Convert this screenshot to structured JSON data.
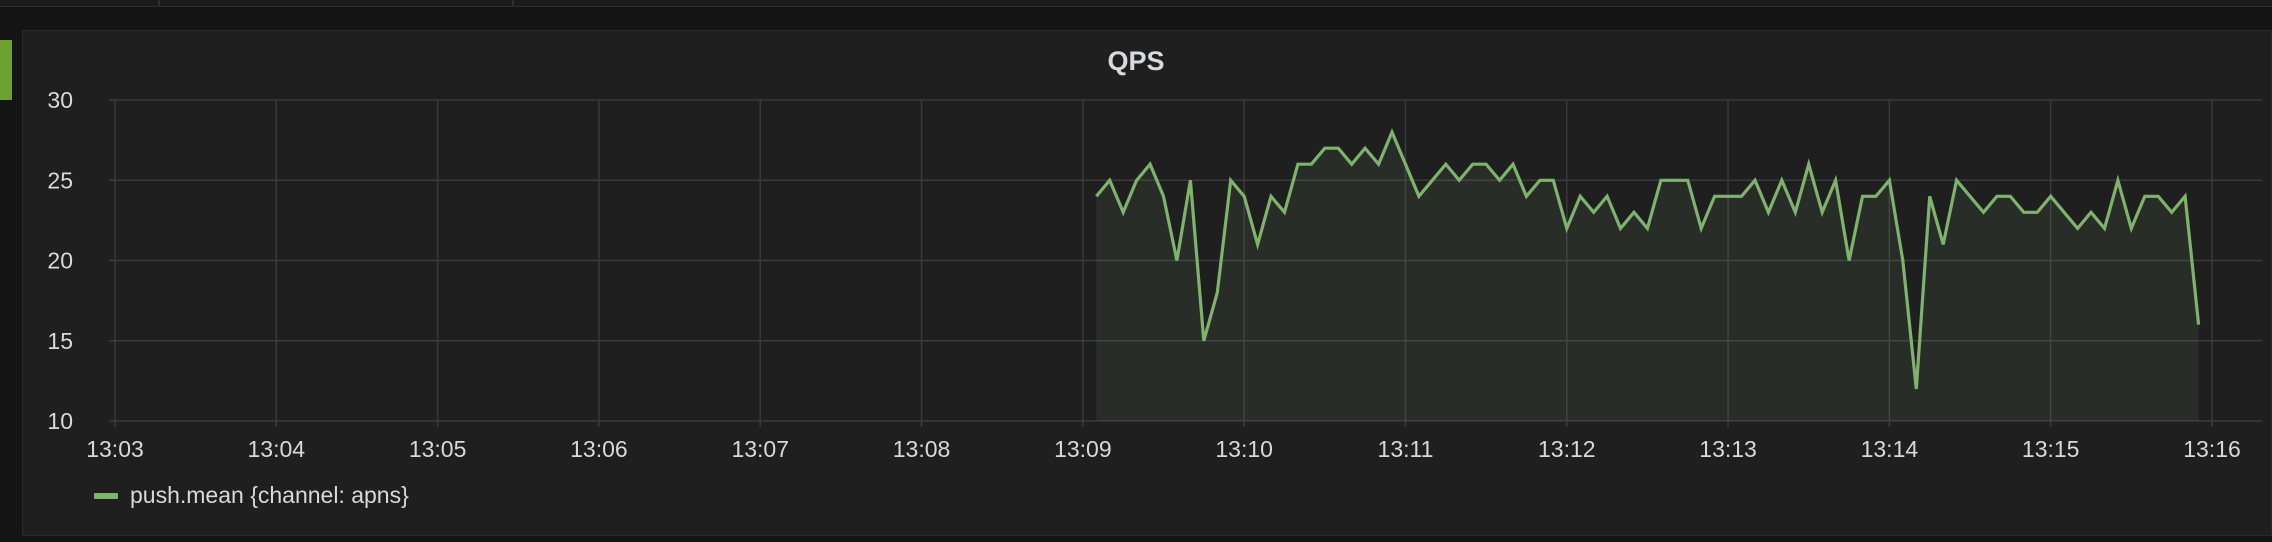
{
  "panel": {
    "title": "QPS"
  },
  "chart_data": {
    "type": "area",
    "title": "QPS",
    "xlabel": "",
    "ylabel": "",
    "x_ticks": [
      "13:03",
      "13:04",
      "13:05",
      "13:06",
      "13:07",
      "13:08",
      "13:09",
      "13:10",
      "13:11",
      "13:12",
      "13:13",
      "13:14",
      "13:15",
      "13:16"
    ],
    "x_range": [
      "13:03",
      "13:16"
    ],
    "y_ticks": [
      10,
      15,
      20,
      25,
      30
    ],
    "ylim": [
      10,
      30
    ],
    "grid": true,
    "legend_placement": "bottom-left",
    "series": [
      {
        "name": "push.mean {channel: apns}",
        "color": "#7eb26d",
        "x": [
          "13:09:05",
          "13:09:10",
          "13:09:15",
          "13:09:20",
          "13:09:25",
          "13:09:30",
          "13:09:35",
          "13:09:40",
          "13:09:45",
          "13:09:50",
          "13:09:55",
          "13:10:00",
          "13:10:05",
          "13:10:10",
          "13:10:15",
          "13:10:20",
          "13:10:25",
          "13:10:30",
          "13:10:35",
          "13:10:40",
          "13:10:45",
          "13:10:50",
          "13:10:55",
          "13:11:00",
          "13:11:05",
          "13:11:10",
          "13:11:15",
          "13:11:20",
          "13:11:25",
          "13:11:30",
          "13:11:35",
          "13:11:40",
          "13:11:45",
          "13:11:50",
          "13:11:55",
          "13:12:00",
          "13:12:05",
          "13:12:10",
          "13:12:15",
          "13:12:20",
          "13:12:25",
          "13:12:30",
          "13:12:35",
          "13:12:40",
          "13:12:45",
          "13:12:50",
          "13:12:55",
          "13:13:00",
          "13:13:05",
          "13:13:10",
          "13:13:15",
          "13:13:20",
          "13:13:25",
          "13:13:30",
          "13:13:35",
          "13:13:40",
          "13:13:45",
          "13:13:50",
          "13:13:55",
          "13:14:00",
          "13:14:05",
          "13:14:10",
          "13:14:15",
          "13:14:20",
          "13:14:25",
          "13:14:30",
          "13:14:35",
          "13:14:40",
          "13:14:45",
          "13:14:50",
          "13:14:55",
          "13:15:00",
          "13:15:05",
          "13:15:10",
          "13:15:15",
          "13:15:20",
          "13:15:25",
          "13:15:30",
          "13:15:35",
          "13:15:40",
          "13:15:45",
          "13:15:50",
          "13:15:55"
        ],
        "values": [
          24,
          25,
          23,
          25,
          26,
          24,
          20,
          25,
          15,
          18,
          25,
          24,
          21,
          24,
          23,
          26,
          26,
          27,
          27,
          26,
          27,
          26,
          28,
          26,
          24,
          25,
          26,
          25,
          26,
          26,
          25,
          26,
          24,
          25,
          25,
          22,
          24,
          23,
          24,
          22,
          23,
          22,
          25,
          25,
          25,
          22,
          24,
          24,
          24,
          25,
          23,
          25,
          23,
          26,
          23,
          25,
          20,
          24,
          24,
          25,
          20,
          12,
          24,
          21,
          25,
          24,
          23,
          24,
          24,
          23,
          23,
          24,
          23,
          22,
          23,
          22,
          25,
          22,
          24,
          24,
          23,
          24,
          16
        ]
      }
    ]
  }
}
